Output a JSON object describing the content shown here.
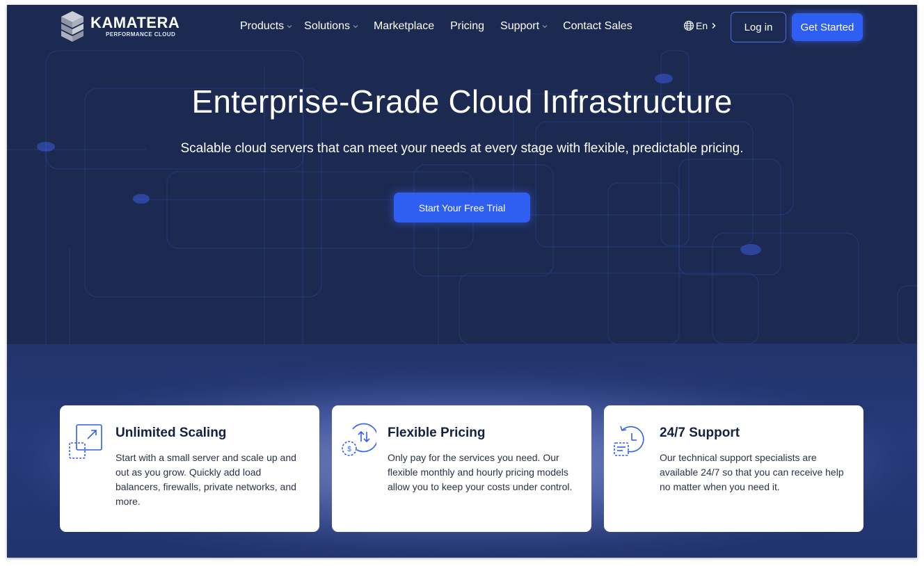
{
  "brand": {
    "name": "KAMATERA",
    "tagline": "PERFORMANCE CLOUD"
  },
  "nav": {
    "items": [
      {
        "label": "Products",
        "has_dropdown": true
      },
      {
        "label": "Solutions",
        "has_dropdown": true
      },
      {
        "label": "Marketplace",
        "has_dropdown": false
      },
      {
        "label": "Pricing",
        "has_dropdown": false
      },
      {
        "label": "Support",
        "has_dropdown": true
      },
      {
        "label": "Contact Sales",
        "has_dropdown": false
      }
    ],
    "language": {
      "label": "En",
      "icon": "globe-icon"
    },
    "login_label": "Log in",
    "cta_label": "Get Started"
  },
  "hero": {
    "title": "Enterprise-Grade Cloud Infrastructure",
    "subtitle": "Scalable cloud servers that can meet your needs at every stage with flexible, predictable pricing.",
    "cta_label": "Start Your Free Trial"
  },
  "features": [
    {
      "icon": "scale-up-icon",
      "title": "Unlimited Scaling",
      "description": "Start with a small server and scale up and out as you grow. Quickly add load balancers, firewalls, private networks, and more."
    },
    {
      "icon": "pricing-icon",
      "title": "Flexible Pricing",
      "description": "Only pay for the services you need. Our flexible monthly and hourly pricing models allow you to keep your costs under control."
    },
    {
      "icon": "support-clock-icon",
      "title": "24/7 Support",
      "description": "Our technical support specialists are available 24/7 so that you can receive help no matter when you need it."
    }
  ],
  "colors": {
    "hero_background": "#1c2a52",
    "accent_blue": "#2f5ef2",
    "card_background": "#ffffff",
    "heading_text": "#142042"
  }
}
